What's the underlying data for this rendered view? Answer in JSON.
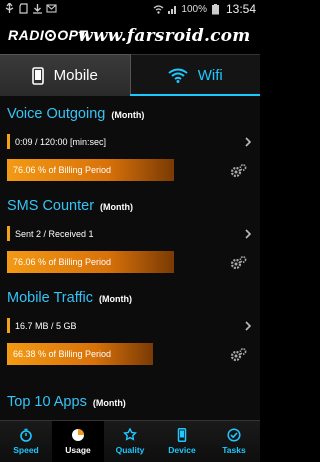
{
  "status_bar": {
    "battery": "100%",
    "time": "13:54"
  },
  "app": {
    "logo_left": "RADI",
    "logo_right": "OPT",
    "watermark": "www.farsroid.com"
  },
  "tabs": [
    {
      "label": "Mobile",
      "icon": "phone-icon",
      "selected": true
    },
    {
      "label": "Wifi",
      "icon": "wifi-icon",
      "selected": false
    }
  ],
  "sections": {
    "voice": {
      "title": "Voice Outgoing",
      "subtitle": "(Month)",
      "detail": "0:09  /  120:00 [min:sec]",
      "billing_text": "76.06 % of Billing Period",
      "billing_percent": 76.06
    },
    "sms": {
      "title": "SMS Counter",
      "subtitle": "(Month)",
      "detail": "Sent 2 / Received 1",
      "billing_text": "76.06 % of Billing Period",
      "billing_percent": 76.06
    },
    "traffic": {
      "title": "Mobile Traffic",
      "subtitle": "(Month)",
      "detail": "16.7 MB / 5 GB",
      "billing_text": "66.38 % of Billing Period",
      "billing_percent": 66.38
    },
    "apps": {
      "title": "Top 10 Apps",
      "subtitle": "(Month)"
    }
  },
  "bottom_nav": [
    {
      "label": "Speed",
      "icon": "stopwatch-icon",
      "active": false
    },
    {
      "label": "Usage",
      "icon": "pie-chart-icon",
      "active": true
    },
    {
      "label": "Quality",
      "icon": "quality-icon",
      "active": false
    },
    {
      "label": "Device",
      "icon": "device-icon",
      "active": false
    },
    {
      "label": "Tasks",
      "icon": "tasks-icon",
      "active": false
    }
  ],
  "colors": {
    "accent_blue": "#36c3f5",
    "bar_orange": "#f39a14",
    "row_accent": "#f3a21a"
  }
}
